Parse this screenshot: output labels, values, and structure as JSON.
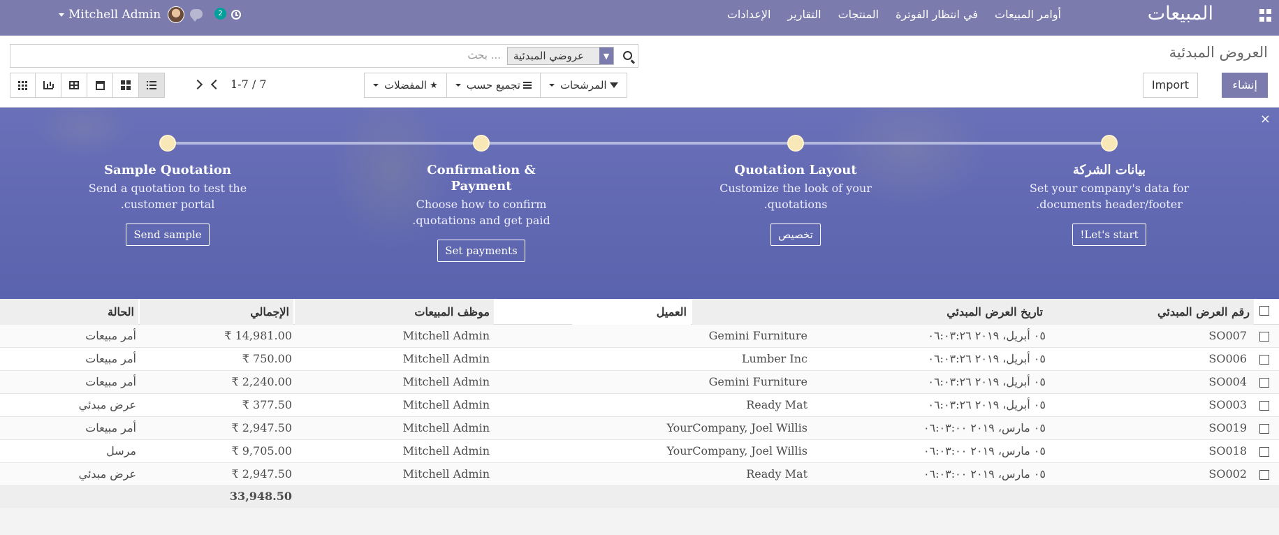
{
  "navbar": {
    "brand": "المبيعات",
    "menu": [
      "أوامر المبيعات",
      "في انتظار الفوترة",
      "المنتجات",
      "التقارير",
      "الإعدادات"
    ],
    "user": "Mitchell Admin",
    "message_count": "2",
    "icons": [
      "apps-grid-icon",
      "chat-icon",
      "clock-icon"
    ],
    "color": "#7c7bad"
  },
  "control": {
    "title": "العروض المبدئية",
    "create_label": "إنشاء",
    "import_label": "Import",
    "search": {
      "facet": "عروضي المبدئية",
      "placeholder": "بحث ..."
    },
    "filters_label": "المرشحات",
    "groupby_label": "تجميع حسب",
    "favorites_label": "المفضلات",
    "pager": "1-7 / 7"
  },
  "banner": {
    "close": "×",
    "steps": [
      {
        "title": "بيانات الشركة",
        "desc": "Set your company's data for documents header/footer.",
        "button": "Let's start!"
      },
      {
        "title": "Quotation Layout",
        "desc": "Customize the look of your quotations.",
        "button": "تخصيص"
      },
      {
        "title": "Confirmation & Payment",
        "desc": "Choose how to confirm quotations and get paid.",
        "button": "Set payments"
      },
      {
        "title": "Sample Quotation",
        "desc": "Send a quotation to test the customer portal.",
        "button": "Send sample"
      }
    ]
  },
  "table": {
    "headers": {
      "number": "رقم العرض المبدئي",
      "date": "تاريخ العرض المبدئي",
      "customer": "العميل",
      "salesperson": "موظف المبيعات",
      "total": "الإجمالي",
      "state": "الحالة"
    },
    "rows": [
      {
        "number": "SO007",
        "date": "٠٥ أبريل، ٢٠١٩ ٠٦:٠٣:٢٦",
        "customer": "Gemini Furniture",
        "salesperson": "Mitchell Admin",
        "total": "₹ 14,981.00",
        "state": "أمر مبيعات"
      },
      {
        "number": "SO006",
        "date": "٠٥ أبريل، ٢٠١٩ ٠٦:٠٣:٢٦",
        "customer": "Lumber Inc",
        "salesperson": "Mitchell Admin",
        "total": "₹ 750.00",
        "state": "أمر مبيعات"
      },
      {
        "number": "SO004",
        "date": "٠٥ أبريل، ٢٠١٩ ٠٦:٠٣:٢٦",
        "customer": "Gemini Furniture",
        "salesperson": "Mitchell Admin",
        "total": "₹ 2,240.00",
        "state": "أمر مبيعات"
      },
      {
        "number": "SO003",
        "date": "٠٥ أبريل، ٢٠١٩ ٠٦:٠٣:٢٦",
        "customer": "Ready Mat",
        "salesperson": "Mitchell Admin",
        "total": "₹ 377.50",
        "state": "عرض مبدئي"
      },
      {
        "number": "SO019",
        "date": "٠٥ مارس، ٢٠١٩ ٠٦:٠٣:٠٠",
        "customer": "YourCompany, Joel Willis",
        "salesperson": "Mitchell Admin",
        "total": "₹ 2,947.50",
        "state": "أمر مبيعات"
      },
      {
        "number": "SO018",
        "date": "٠٥ مارس، ٢٠١٩ ٠٦:٠٣:٠٠",
        "customer": "YourCompany, Joel Willis",
        "salesperson": "Mitchell Admin",
        "total": "₹ 9,705.00",
        "state": "مرسل"
      },
      {
        "number": "SO002",
        "date": "٠٥ مارس، ٢٠١٩ ٠٦:٠٣:٠٠",
        "customer": "Ready Mat",
        "salesperson": "Mitchell Admin",
        "total": "₹ 2,947.50",
        "state": "عرض مبدئي"
      }
    ],
    "footer_total": "33,948.50"
  }
}
